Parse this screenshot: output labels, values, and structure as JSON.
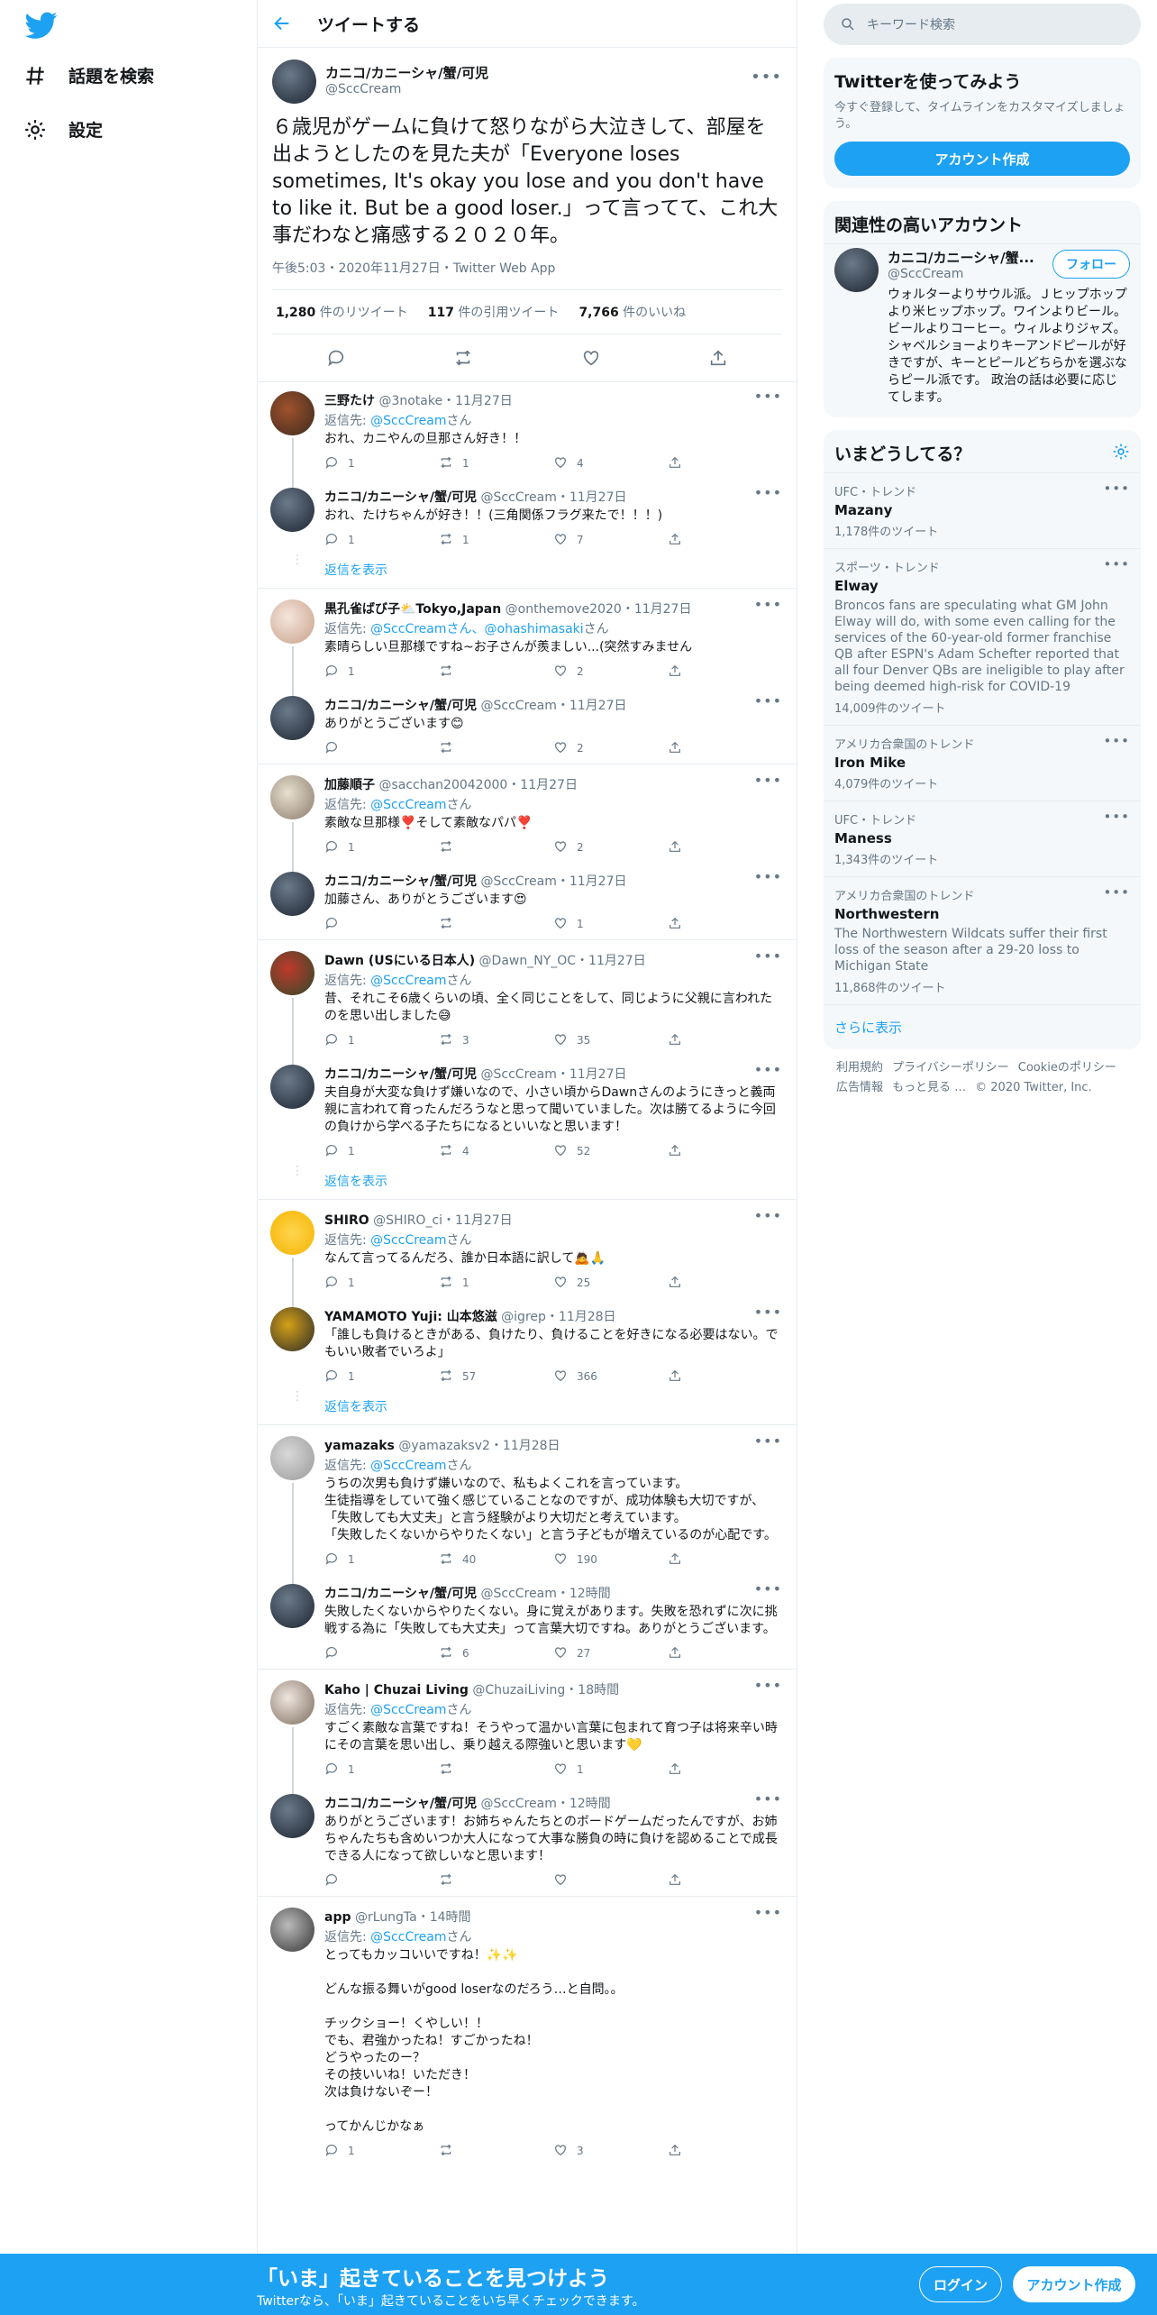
{
  "nav": {
    "explore": "話題を検索",
    "settings": "設定"
  },
  "header": {
    "title": "ツイートする"
  },
  "main_tweet": {
    "display_name": "カニコ/カニーシャ/蟹/可児",
    "handle": "@SccCream",
    "text": "６歳児がゲームに負けて怒りながら大泣きして、部屋を出ようとしたのを見た夫が「Everyone loses sometimes, It's okay you lose and you don't have to like it. But be a good loser.」って言ってて、これ大事だわなと痛感する２０２０年。",
    "meta": "午後5:03・2020年11月27日・Twitter Web App",
    "retweets": "1,280",
    "retweets_label": " 件のリツイート",
    "quotes": "117",
    "quotes_label": " 件の引用ツイート",
    "likes": "7,766",
    "likes_label": " 件のいいね"
  },
  "replying_to_prefix": "返信先: ",
  "replying_suffix": "さん",
  "show_replies": "返信を表示",
  "replies": [
    {
      "name": "三野たけ",
      "handle": "@3notake",
      "date": "・11月27日",
      "reply_to": "@SccCream",
      "text": "おれ、カニやんの旦那さん好き！！",
      "replies": "1",
      "retweets": "1",
      "likes": "4"
    },
    {
      "name": "カニコ/カニーシャ/蟹/可児",
      "handle": "@SccCream",
      "date": "・11月27日",
      "reply_to": "",
      "text": "おれ、たけちゃんが好き！！(三角関係フラグ来たで！！！)",
      "replies": "1",
      "retweets": "1",
      "likes": "7"
    },
    {
      "name": "黒孔雀ばび子⛅Tokyo,Japan",
      "handle": "@onthemove2020",
      "date": "・11月27日",
      "reply_to": "@SccCreamさん、@ohashimasaki",
      "text": "素晴らしい旦那様ですね~お子さんが羨ましい...(突然すみません",
      "replies": "1",
      "retweets": "",
      "likes": "2"
    },
    {
      "name": "カニコ/カニーシャ/蟹/可児",
      "handle": "@SccCream",
      "date": "・11月27日",
      "reply_to": "",
      "text": "ありがとうございます😊",
      "replies": "",
      "retweets": "",
      "likes": "2"
    },
    {
      "name": "加藤順子",
      "handle": "@sacchan20042000",
      "date": "・11月27日",
      "reply_to": "@SccCream",
      "text": "素敵な旦那様❣️そして素敵なパパ❣️",
      "replies": "1",
      "retweets": "",
      "likes": "2"
    },
    {
      "name": "カニコ/カニーシャ/蟹/可児",
      "handle": "@SccCream",
      "date": "・11月27日",
      "reply_to": "",
      "text": "加藤さん、ありがとうございます😍",
      "replies": "",
      "retweets": "",
      "likes": "1"
    },
    {
      "name": "Dawn (USにいる日本人)",
      "handle": "@Dawn_NY_OC",
      "date": "・11月27日",
      "reply_to": "@SccCream",
      "text": "昔、それこそ6歳くらいの頃、全く同じことをして、同じように父親に言われたのを思い出しました😅",
      "replies": "1",
      "retweets": "3",
      "likes": "35"
    },
    {
      "name": "カニコ/カニーシャ/蟹/可児",
      "handle": "@SccCream",
      "date": "・11月27日",
      "reply_to": "",
      "text": "夫自身が大変な負けず嫌いなので、小さい頃からDawnさんのようにきっと義両親に言われて育ったんだろうなと思って聞いていました。次は勝てるように今回の負けから学べる子たちになるといいなと思います！",
      "replies": "1",
      "retweets": "4",
      "likes": "52"
    },
    {
      "name": "SHIRO",
      "handle": "@SHIRO_ci",
      "date": "・11月27日",
      "reply_to": "@SccCream",
      "text": "なんて言ってるんだろ、誰か日本語に訳して🙇🙏",
      "replies": "1",
      "retweets": "1",
      "likes": "25"
    },
    {
      "name": "YAMAMOTO Yuji: 山本悠滋",
      "handle": "@igrep",
      "date": "・11月28日",
      "reply_to": "",
      "text": "「誰しも負けるときがある、負けたり、負けることを好きになる必要はない。でもいい敗者でいろよ」",
      "replies": "1",
      "retweets": "57",
      "likes": "366"
    },
    {
      "name": "yamazaks",
      "handle": "@yamazaksv2",
      "date": "・11月28日",
      "reply_to": "@SccCream",
      "text": "うちの次男も負けず嫌いなので、私もよくこれを言っています。\n生徒指導をしていて強く感じていることなのですが、成功体験も大切ですが、「失敗しても大丈夫」と言う経験がより大切だと考えています。\n「失敗したくないからやりたくない」と言う子どもが増えているのが心配です。",
      "replies": "1",
      "retweets": "40",
      "likes": "190"
    },
    {
      "name": "カニコ/カニーシャ/蟹/可児",
      "handle": "@SccCream",
      "date": "・12時間",
      "reply_to": "",
      "text": "失敗したくないからやりたくない。身に覚えがあります。失敗を恐れずに次に挑戦する為に「失敗しても大丈夫」って言葉大切ですね。ありがとうございます。",
      "replies": "",
      "retweets": "6",
      "likes": "27"
    },
    {
      "name": "Kaho | Chuzai Living",
      "handle": "@ChuzaiLiving",
      "date": "・18時間",
      "reply_to": "@SccCream",
      "text": "すごく素敵な言葉ですね！そうやって温かい言葉に包まれて育つ子は将来辛い時にその言葉を思い出し、乗り越える際強いと思います💛",
      "replies": "1",
      "retweets": "",
      "likes": "1"
    },
    {
      "name": "カニコ/カニーシャ/蟹/可児",
      "handle": "@SccCream",
      "date": "・12時間",
      "reply_to": "",
      "text": "ありがとうございます！お姉ちゃんたちとのボードゲームだったんですが、お姉ちゃんたちも含めいつか大人になって大事な勝負の時に負けを認めることで成長できる人になって欲しいなと思います！",
      "replies": "",
      "retweets": "",
      "likes": ""
    },
    {
      "name": "app",
      "handle": "@rLungTa",
      "date": "・14時間",
      "reply_to": "@SccCream",
      "text": "とってもカッコいいですね！✨✨\n\nどんな振る舞いがgood loserなのだろう…と自問。。\n\nチックショー！くやしい！！\nでも、君強かったね！すごかったね！\nどうやったのー？\nその技いいね！いただき！\n次は負けないぞー！\n\nってかんじかなぁ",
      "replies": "1",
      "retweets": "",
      "likes": "3"
    }
  ],
  "search": {
    "placeholder": "キーワード検索"
  },
  "try_twitter": {
    "title": "Twitterを使ってみよう",
    "subtitle": "今すぐ登録して、タイムラインをカスタマイズしましょう。",
    "button": "アカウント作成"
  },
  "relevant": {
    "title": "関連性の高いアカウント",
    "name": "カニコ/カニーシャ/蟹...",
    "handle": "@SccCream",
    "follow": "フォロー",
    "bio": "ウォルターよりサウル派。Ｊヒップホップより米ヒップホップ。ワインよりビール。ビールよりコーヒー。ウィルよりジャズ。シャベルショーよりキーアンドピールが好きですが、キーとピールどちらかを選ぶならピール派です。 政治の話は必要に応じてします。"
  },
  "trends": {
    "title": "いまどうしてる？",
    "items": [
      {
        "context": "UFC・トレンド",
        "name": "Mazany",
        "desc": "",
        "count": "1,178件のツイート"
      },
      {
        "context": "スポーツ・トレンド",
        "name": "Elway",
        "desc": "Broncos fans are speculating what GM John Elway will do, with some even calling for the services of the 60-year-old former franchise QB after ESPN's Adam Schefter reported that all four Denver QBs are ineligible to play after being deemed high-risk for COVID-19",
        "count": "14,009件のツイート"
      },
      {
        "context": "アメリカ合衆国のトレンド",
        "name": "Iron Mike",
        "desc": "",
        "count": "4,079件のツイート"
      },
      {
        "context": "UFC・トレンド",
        "name": "Maness",
        "desc": "",
        "count": "1,343件のツイート"
      },
      {
        "context": "アメリカ合衆国のトレンド",
        "name": "Northwestern",
        "desc": "The Northwestern Wildcats suffer their first loss of the season after a 29-20 loss to Michigan State",
        "count": "11,868件のツイート"
      }
    ],
    "show_more": "さらに表示"
  },
  "footer": {
    "links": [
      "利用規約",
      "プライバシーポリシー",
      "Cookieのポリシー",
      "広告情報",
      "もっと見る …",
      "© 2020 Twitter, Inc."
    ]
  },
  "bottom_bar": {
    "title": "「いま」起きていることを見つけよう",
    "subtitle": "Twitterなら、「いま」起きていることをいち早くチェックできます。",
    "login": "ログイン",
    "signup": "アカウント作成"
  },
  "colors": {
    "accent": "#1da1f2",
    "secondary_text": "#657786",
    "border": "#e6ecf0"
  }
}
